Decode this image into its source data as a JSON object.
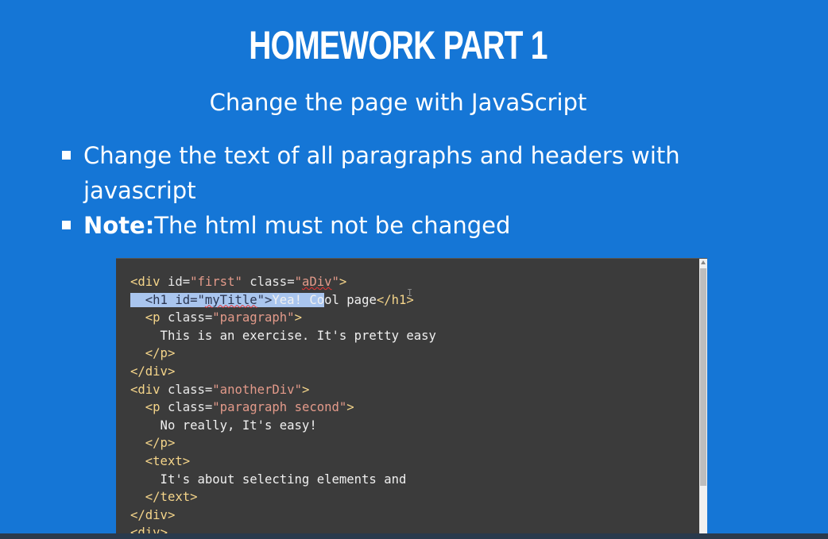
{
  "slide": {
    "title": "HOMEWORK PART 1",
    "subtitle": "Change the page with JavaScript",
    "bullets": [
      {
        "bold": "",
        "text": "Change the text of all paragraphs and headers with javascript"
      },
      {
        "bold": "Note:",
        "text": "The html must not be changed"
      }
    ]
  },
  "code_window": {
    "lines": [
      "<div id=\"first\" class=\"aDiv\">",
      "  <h1 id=\"myTitle\">Yea! Cool page</h1>",
      "  <p class=\"paragraph\">",
      "    This is an exercise. It's pretty easy",
      "  </p>",
      "</div>",
      "<div class=\"anotherDiv\">",
      "  <p class=\"paragraph second\">",
      "    No really, It's easy!",
      "  </p>",
      "  <text>",
      "    It's about selecting elements and",
      "  </text>",
      "</div>",
      "<div>"
    ],
    "selected_text": "  <h1 id=\"myTitle\">Yea! Co"
  },
  "colors": {
    "slide_background": "#1576d6",
    "code_background": "#3b3b3b",
    "tag": "#f5d58a",
    "string": "#e39a8a",
    "selection": "#a9c5ee"
  }
}
